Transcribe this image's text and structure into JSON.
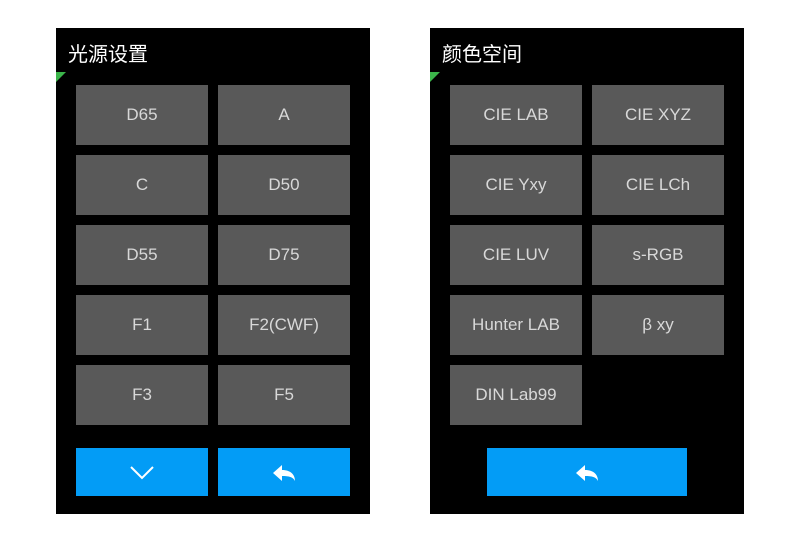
{
  "colors": {
    "panel_bg": "#000000",
    "button_bg": "#595959",
    "button_fg": "#d8d8d8",
    "accent": "#039cf6",
    "indicator": "#3bb54a"
  },
  "panels": [
    {
      "title": "光源设置",
      "options": [
        "D65",
        "A",
        "C",
        "D50",
        "D55",
        "D75",
        "F1",
        "F2(CWF)",
        "F3",
        "F5"
      ],
      "footer": [
        "down",
        "back"
      ]
    },
    {
      "title": "颜色空间",
      "options": [
        "CIE LAB",
        "CIE XYZ",
        "CIE Yxy",
        "CIE LCh",
        "CIE LUV",
        "s-RGB",
        "Hunter LAB",
        "β xy",
        "DIN Lab99"
      ],
      "footer": [
        "back"
      ]
    }
  ]
}
